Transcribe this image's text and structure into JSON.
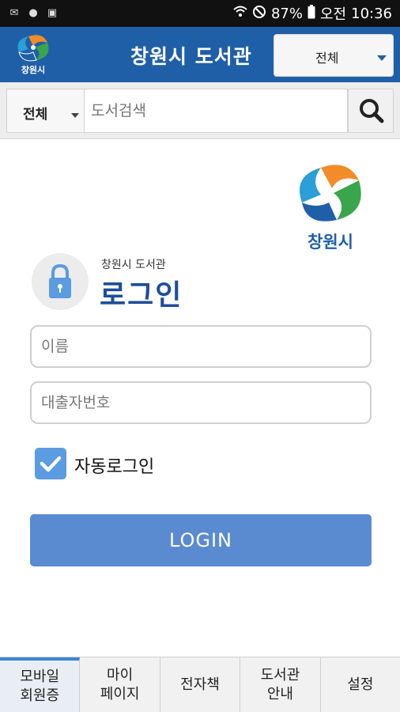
{
  "status_bar": {
    "battery": "87%",
    "ampm": "오전",
    "time": "10:36"
  },
  "header": {
    "logo_caption": "창원시",
    "title": "창원시 도서관",
    "scope_select": "전체"
  },
  "search": {
    "category_select": "전체",
    "placeholder": "도서검색"
  },
  "brand": {
    "logo_caption": "창원시"
  },
  "login": {
    "subtitle": "창원시 도서관",
    "title": "로그인",
    "name_placeholder": "이름",
    "card_placeholder": "대출자번호",
    "auto_login_label": "자동로그인",
    "auto_login_checked": true,
    "button_label": "LOGIN"
  },
  "tabs": [
    {
      "label": "모바일\n회원증",
      "active": true
    },
    {
      "label": "마이\n페이지",
      "active": false
    },
    {
      "label": "전자책",
      "active": false
    },
    {
      "label": "도서관\n안내",
      "active": false
    },
    {
      "label": "설정",
      "active": false
    }
  ],
  "colors": {
    "header_bg": "#1f5fa8",
    "button_bg": "#5a8bd0",
    "title_text": "#1d4e99"
  }
}
